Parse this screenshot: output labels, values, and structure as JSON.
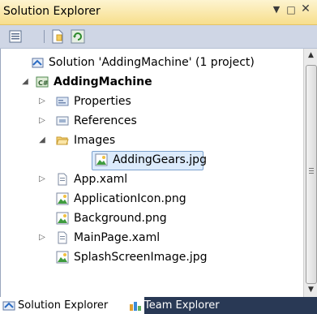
{
  "panel": {
    "title": "Solution Explorer",
    "pin_icon": "dropdown-icon",
    "max_icon": "maximize-icon",
    "close_icon": "close-icon"
  },
  "toolbar": {
    "buttons": [
      "properties-icon",
      "show-all-files-icon",
      "refresh-icon"
    ]
  },
  "tree": {
    "solution": "Solution 'AddingMachine' (1 project)",
    "project": "AddingMachine",
    "properties": "Properties",
    "references": "References",
    "images": "Images",
    "adding_gears": "AddingGears.jpg",
    "app_xaml": "App.xaml",
    "application_icon": "ApplicationIcon.png",
    "background": "Background.png",
    "main_page": "MainPage.xaml",
    "splash": "SplashScreenImage.jpg"
  },
  "tabs": {
    "solution_explorer": "Solution Explorer",
    "team_explorer": "Team Explorer"
  },
  "colors": {
    "titlebar": "#f7de8c",
    "selection": "#dcebfc",
    "tab_strip": "#293955"
  }
}
